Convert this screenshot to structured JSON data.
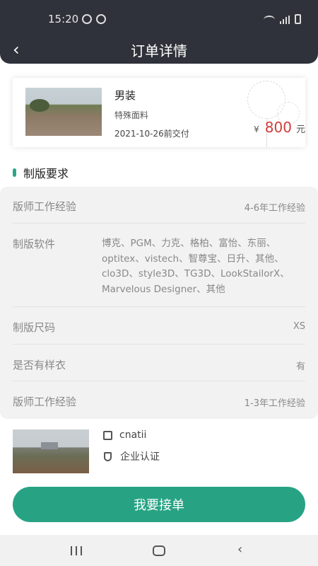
{
  "status": {
    "time": "15:20"
  },
  "header": {
    "back_icon": "‹",
    "title": "订单详情"
  },
  "order": {
    "name": "男装",
    "fabric": "特殊面料",
    "delivery": "2021-10-26前交付",
    "currency": "¥",
    "price": "800",
    "unit": "元"
  },
  "section": {
    "title": "制版要求"
  },
  "requirements": [
    {
      "label": "版师工作经验",
      "value": "4-6年工作经验"
    },
    {
      "label": "制版软件",
      "value": "博克、PGM、力克、格柏、富怡、东丽、optitex、vistech、智尊宝、日升、其他、clo3D、style3D、TG3D、LookStailorX、Marvelous Designer、其他"
    },
    {
      "label": "制版尺码",
      "value": "XS"
    },
    {
      "label": "是否有样衣",
      "value": "有"
    },
    {
      "label": "版师工作经验",
      "value": "1-3年工作经验"
    }
  ],
  "company": {
    "name": "cnatii",
    "certification": "企业认证"
  },
  "accept_button": "我要接单",
  "colors": {
    "accent": "#27a384",
    "price": "#d23b3b",
    "header": "#2f323a"
  }
}
